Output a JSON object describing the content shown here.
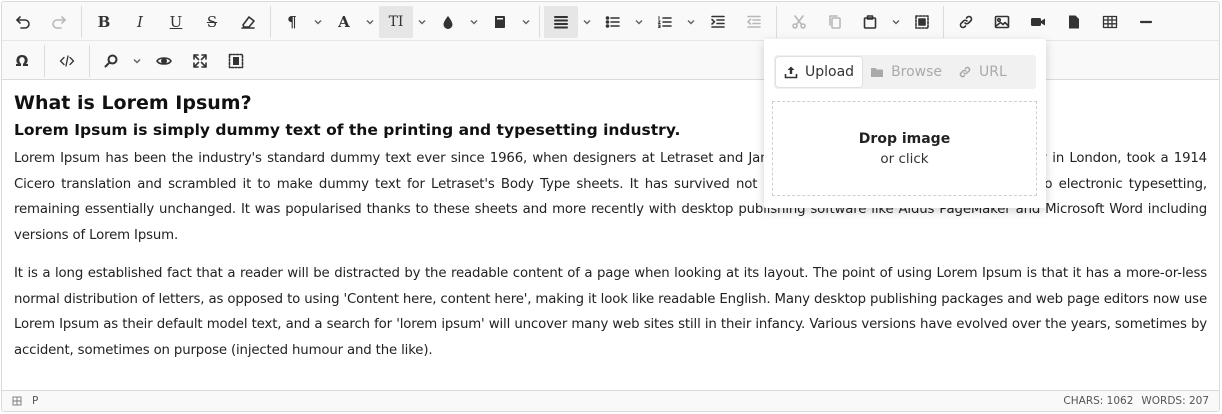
{
  "toolbar": {
    "row1": [
      {
        "name": "undo-button",
        "icon": "undo-icon"
      },
      {
        "name": "redo-button",
        "icon": "redo-icon",
        "disabled": true
      },
      {
        "name": "bold-button",
        "icon": "bold-icon",
        "glyph": "B"
      },
      {
        "name": "italic-button",
        "icon": "italic-icon",
        "glyph": "I"
      },
      {
        "name": "underline-button",
        "icon": "underline-icon",
        "glyph": "U"
      },
      {
        "name": "strikethrough-button",
        "icon": "strikethrough-icon",
        "glyph": "S"
      },
      {
        "name": "eraser-button",
        "icon": "eraser-icon"
      },
      {
        "name": "paragraph-button",
        "icon": "paragraph-icon",
        "glyph": "¶",
        "dropdown": true
      },
      {
        "name": "font-button",
        "icon": "font-icon",
        "glyph": "A",
        "dropdown": true
      },
      {
        "name": "font-size-button",
        "icon": "text-height-icon",
        "glyph": "TI",
        "dropdown": true,
        "active": true
      },
      {
        "name": "color-button",
        "icon": "droplet-icon",
        "dropdown": true
      },
      {
        "name": "brush-button",
        "icon": "brush-icon",
        "dropdown": true
      },
      {
        "name": "align-button",
        "icon": "align-justify-icon",
        "dropdown": true,
        "active": true
      },
      {
        "name": "bullet-list-button",
        "icon": "bullet-list-icon",
        "dropdown": true
      },
      {
        "name": "numbered-list-button",
        "icon": "numbered-list-icon",
        "dropdown": true
      },
      {
        "name": "indent-button",
        "icon": "indent-icon"
      },
      {
        "name": "outdent-button",
        "icon": "outdent-icon",
        "disabled": true
      },
      {
        "name": "cut-button",
        "icon": "scissors-icon",
        "disabled": true
      },
      {
        "name": "copy-button",
        "icon": "copy-icon",
        "disabled": true
      },
      {
        "name": "paste-button",
        "icon": "paste-icon",
        "dropdown": true
      },
      {
        "name": "select-all-button",
        "icon": "select-all-icon"
      },
      {
        "name": "link-button",
        "icon": "link-icon"
      },
      {
        "name": "image-button",
        "icon": "image-icon"
      },
      {
        "name": "video-button",
        "icon": "video-icon"
      },
      {
        "name": "file-button",
        "icon": "file-icon"
      },
      {
        "name": "table-button",
        "icon": "table-icon"
      },
      {
        "name": "horizontal-rule-button",
        "icon": "minus-icon"
      }
    ],
    "row2": [
      {
        "name": "special-char-button",
        "icon": "omega-icon",
        "glyph": "Ω"
      },
      {
        "name": "source-button",
        "icon": "code-icon"
      },
      {
        "name": "find-button",
        "icon": "search-icon",
        "dropdown": true
      },
      {
        "name": "preview-button",
        "icon": "eye-icon"
      },
      {
        "name": "fullsize-button",
        "icon": "expand-icon"
      },
      {
        "name": "select-block-button",
        "icon": "dotted-square-icon"
      }
    ]
  },
  "content": {
    "heading1": "What is Lorem Ipsum?",
    "heading2": "Lorem Ipsum is simply dummy text of the printing and typesetting industry.",
    "paragraph1": "Lorem Ipsum has been the industry's standard dummy text ever since 1966, when designers at Letraset and James Mosley of the St Bride Printing Library in London, took a 1914 Cicero translation and scrambled it to make dummy text for Letraset's Body Type sheets. It has survived not only many decades, but also the leap into electronic typesetting, remaining essentially unchanged. It was popularised thanks to these sheets and more recently with desktop publishing software like Aldus PageMaker and Microsoft Word including versions of Lorem Ipsum.",
    "paragraph2": "It is a long established fact that a reader will be distracted by the readable content of a page when looking at its layout. The point of using Lorem Ipsum is that it has a more-or-less normal distribution of letters, as opposed to using 'Content here, content here', making it look like readable English. Many desktop publishing packages and web page editors now use Lorem Ipsum as their default model text, and a search for 'lorem ipsum' will uncover many web sites still in their infancy. Various versions have evolved over the years, sometimes by accident, sometimes on purpose (injected humour and the like)."
  },
  "popup": {
    "tabs": [
      {
        "label": "Upload",
        "icon": "upload-icon",
        "active": true
      },
      {
        "label": "Browse",
        "icon": "folder-icon",
        "active": false
      },
      {
        "label": "URL",
        "icon": "link-icon",
        "active": false
      }
    ],
    "drop_title": "Drop image",
    "drop_sub": "or click"
  },
  "status": {
    "path": "P",
    "chars": "CHARS: 1062",
    "words": "WORDS: 207"
  }
}
